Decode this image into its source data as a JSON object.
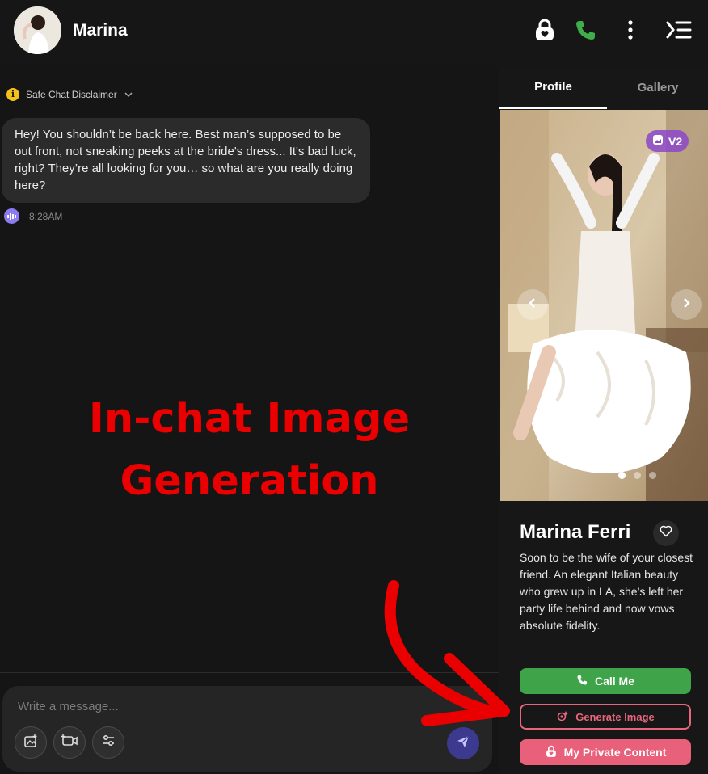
{
  "header": {
    "name": "Marina",
    "icons": [
      "lock-heart-icon",
      "phone-icon",
      "more-vertical-icon",
      "collapse-panel-icon"
    ],
    "phone_color": "#3fae4a"
  },
  "chat": {
    "disclaimer_label": "Safe Chat Disclaimer",
    "message_text": "Hey! You shouldn’t be back here. Best man’s supposed to be out front, not sneaking peeks at the bride's dress... It's bad luck, right? They’re all looking for you… so what are you really doing here?",
    "message_time": "8:28AM",
    "overlay_line1": "In-chat Image",
    "overlay_line2": "Generation",
    "overlay_color": "#ea0000"
  },
  "composer": {
    "placeholder": "Write a message...",
    "tools": [
      "image-icon",
      "video-icon",
      "settings-sliders-icon"
    ],
    "send_icon": "send-icon"
  },
  "panel": {
    "tabs": [
      {
        "label": "Profile",
        "active": true
      },
      {
        "label": "Gallery",
        "active": false
      }
    ],
    "badge": "V2",
    "profile_name": "Marina Ferri",
    "bio": "Soon to be the wife of your closest friend. An elegant Italian beauty who grew up in LA, she’s left her party life behind and now vows absolute fidelity.",
    "call_label": "Call Me",
    "generate_label": "Generate Image",
    "private_label": "My Private Content",
    "call_color": "#3fa34a",
    "accent_color": "#e9607a",
    "carousel_active_index": 0,
    "carousel_count": 3
  }
}
